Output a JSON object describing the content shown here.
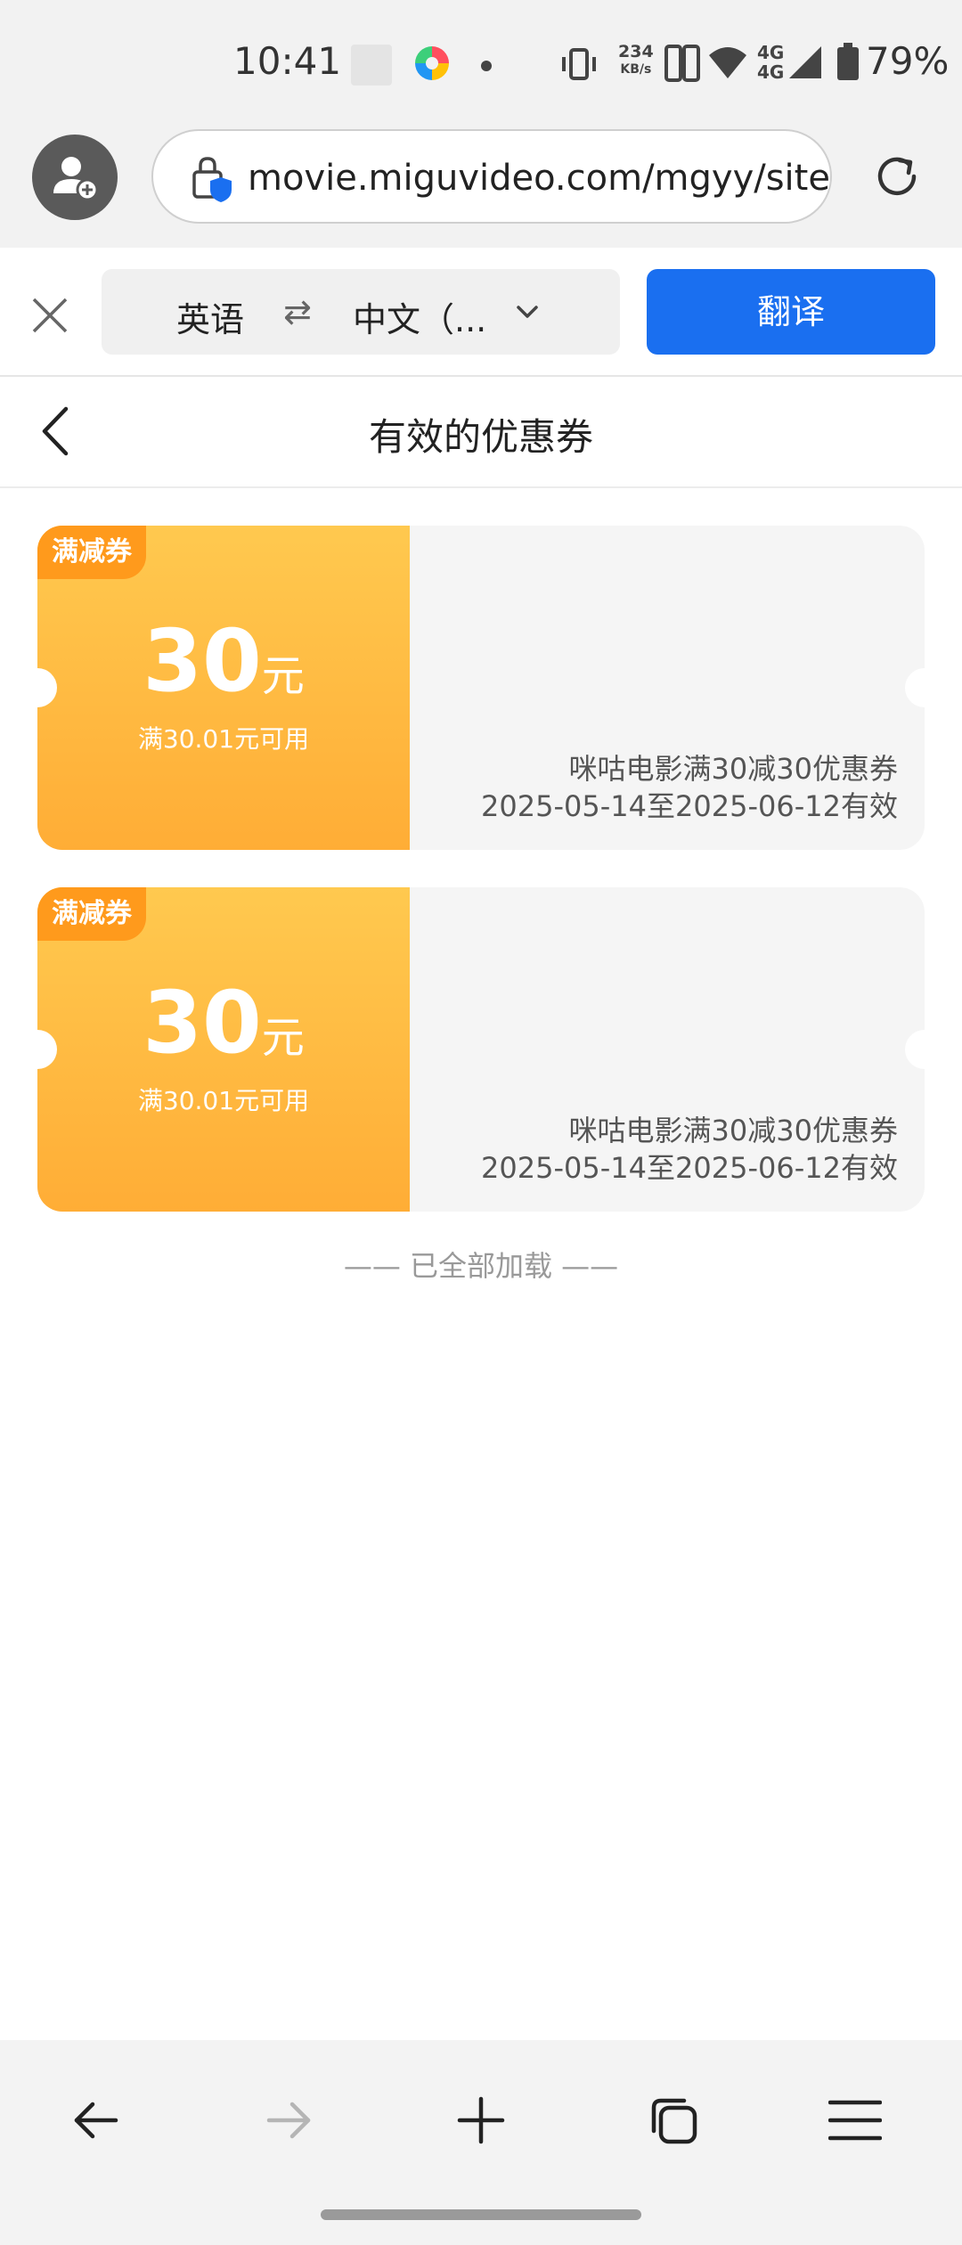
{
  "status_bar": {
    "time": "10:41",
    "net_speed_value": "234",
    "net_speed_unit": "KB/s",
    "net_type_1": "4G",
    "net_type_2": "4G",
    "battery": "79%"
  },
  "browser": {
    "url": "movie.miguvideo.com/mgyy/site/",
    "icons": [
      "add-user-icon",
      "secure-lock-icon",
      "reload-icon"
    ]
  },
  "translate_bar": {
    "source_lang": "英语",
    "swap_glyph": "⇄",
    "target_lang": "中文（...",
    "translate_label": "翻译",
    "accent": "#1a6ff0"
  },
  "page": {
    "title": "有效的优惠券"
  },
  "coupons": [
    {
      "tag": "满减券",
      "amount": "30",
      "unit": "元",
      "condition": "满30.01元可用",
      "name": "咪咕电影满30减30优惠券",
      "validity": "2025-05-14至2025-06-12有效"
    },
    {
      "tag": "满减券",
      "amount": "30",
      "unit": "元",
      "condition": "满30.01元可用",
      "name": "咪咕电影满30减30优惠券",
      "validity": "2025-05-14至2025-06-12有效"
    }
  ],
  "list_footer": "—— 已全部加载 ——",
  "colors": {
    "coupon_top": "#ffc94f",
    "coupon_bottom": "#ffad36",
    "tag_bg": "#ff9a1c"
  },
  "bottom_nav": [
    "back-icon",
    "forward-icon",
    "new-tab-icon",
    "tabs-icon",
    "menu-icon"
  ]
}
